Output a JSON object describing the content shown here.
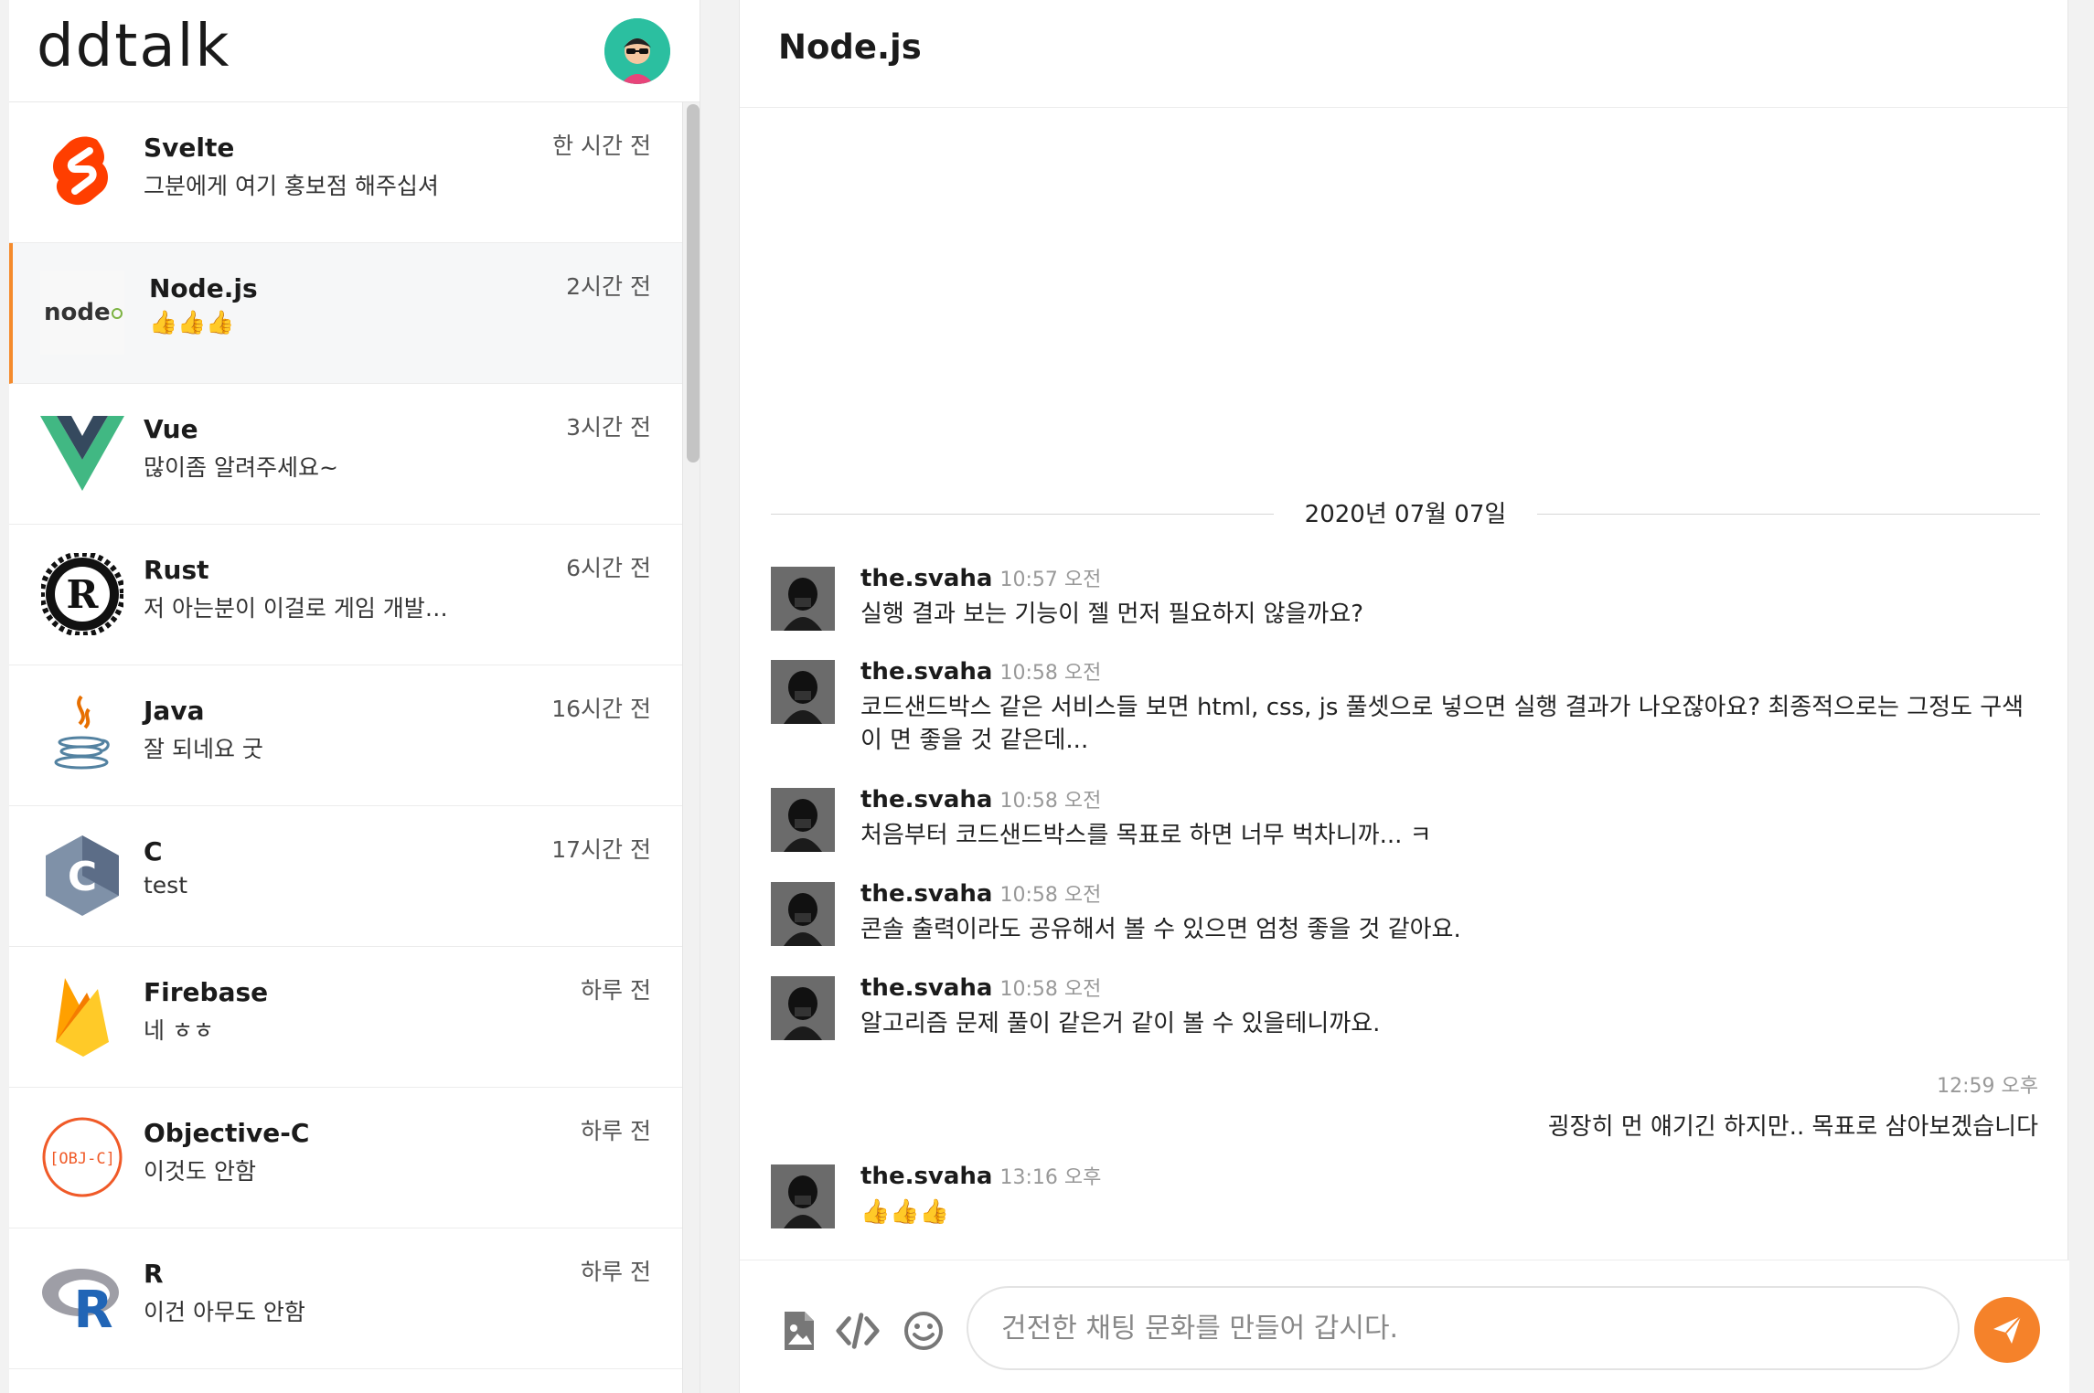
{
  "app": {
    "brand": "ddtalk"
  },
  "channels": [
    {
      "name": "Svelte",
      "last": "그분에게 여기 홍보점 해주십셔",
      "time": "한 시간 전",
      "icon": "svelte-logo"
    },
    {
      "name": "Node.js",
      "last": "👍👍👍",
      "time": "2시간 전",
      "icon": "nodejs-logo",
      "logo_text": "node"
    },
    {
      "name": "Vue",
      "last": "많이좀 알려주세요~",
      "time": "3시간 전",
      "icon": "vue-logo"
    },
    {
      "name": "Rust",
      "last": "저 아는분이 이걸로 게임 개발…",
      "time": "6시간 전",
      "icon": "rust-logo",
      "logo_text": "R"
    },
    {
      "name": "Java",
      "last": "잘 되네요 굿",
      "time": "16시간 전",
      "icon": "java-logo"
    },
    {
      "name": "C",
      "last": "test",
      "time": "17시간 전",
      "icon": "c-logo",
      "logo_text": "C"
    },
    {
      "name": "Firebase",
      "last": "네 ㅎㅎ",
      "time": "하루 전",
      "icon": "firebase-logo"
    },
    {
      "name": "Objective-C",
      "last": "이것도 안함",
      "time": "하루 전",
      "icon": "objc-logo",
      "logo_text": "[OBJ-C]"
    },
    {
      "name": "R",
      "last": "이건 아무도 안함",
      "time": "하루 전",
      "icon": "r-logo",
      "logo_text": "R"
    }
  ],
  "chat": {
    "title": "Node.js",
    "date": "2020년 07월 07일",
    "messages": [
      {
        "user": "the.svaha",
        "time": "10:57 오전",
        "text": "실행 결과 보는 기능이 젤 먼저 필요하지 않을까요?"
      },
      {
        "user": "the.svaha",
        "time": "10:58 오전",
        "text": "코드샌드박스 같은 서비스들 보면 html, css, js 풀셋으로 넣으면 실행 결과가 나오잖아요? 최종적으로는 그정도 구색이 면 좋을 것 같은데..."
      },
      {
        "user": "the.svaha",
        "time": "10:58 오전",
        "text": "처음부터 코드샌드박스를 목표로 하면 너무 벅차니까... ㅋ"
      },
      {
        "user": "the.svaha",
        "time": "10:58 오전",
        "text": "콘솔 출력이라도 공유해서 볼 수 있으면 엄청 좋을 것 같아요."
      },
      {
        "user": "the.svaha",
        "time": "10:58 오전",
        "text": "알고리즘 문제 풀이 같은거 같이 볼 수 있을테니까요."
      }
    ],
    "mine": {
      "time": "12:59 오후",
      "text": "굉장히 먼 얘기긴 하지만.. 목표로 삼아보겠습니다"
    },
    "last_message": {
      "user": "the.svaha",
      "time": "13:16 오후",
      "text": "👍👍👍"
    },
    "composer": {
      "placeholder": "건전한 채팅 문화를 만들어 갑시다.",
      "tools": [
        "image-upload-icon",
        "code-icon",
        "emoji-icon"
      ],
      "send_icon": "send-icon"
    }
  },
  "colors": {
    "accent": "#f5822a",
    "active_border": "#f58b2c"
  }
}
